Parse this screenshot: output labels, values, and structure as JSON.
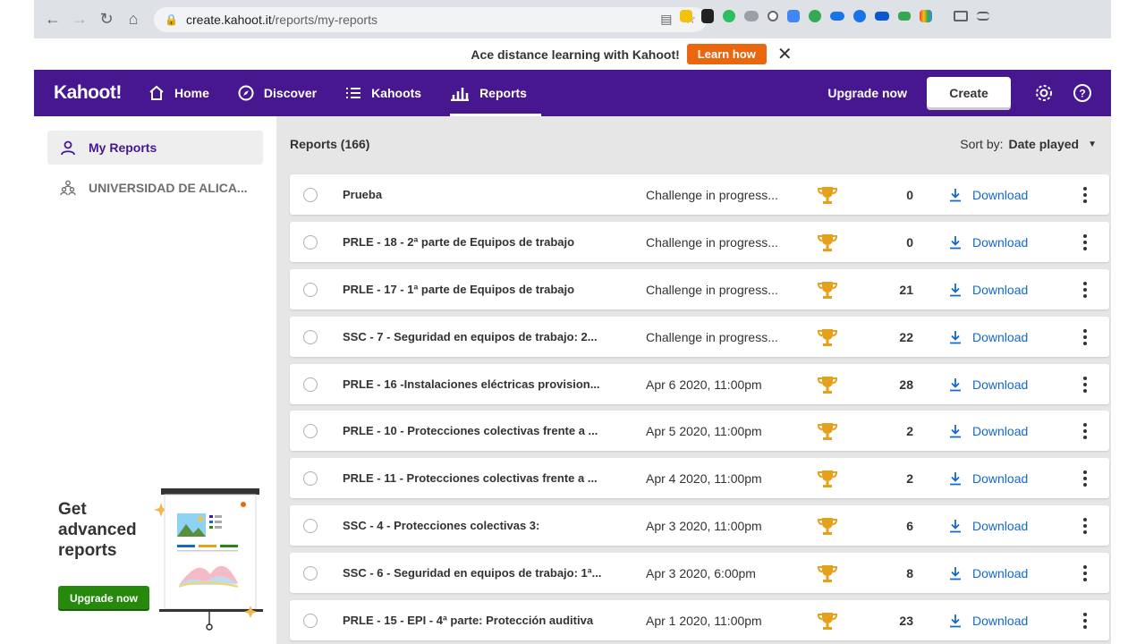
{
  "browser": {
    "url_host": "create.kahoot.it",
    "url_path": "/reports/my-reports"
  },
  "banner": {
    "message": "Ace distance learning with Kahoot!",
    "cta": "Learn how"
  },
  "topbar": {
    "logo": "Kahoot!",
    "nav": [
      {
        "label": "Home",
        "icon": "home-icon"
      },
      {
        "label": "Discover",
        "icon": "compass-icon"
      },
      {
        "label": "Kahoots",
        "icon": "list-icon"
      },
      {
        "label": "Reports",
        "icon": "bar-chart-icon",
        "active": true
      }
    ],
    "upgrade": "Upgrade now",
    "create": "Create"
  },
  "sidebar": {
    "items": [
      {
        "label": "My Reports",
        "icon": "user-icon",
        "active": true
      },
      {
        "label": "UNIVERSIDAD DE ALICA...",
        "icon": "group-icon",
        "active": false
      }
    ],
    "promo": {
      "title": "Get advanced reports",
      "button": "Upgrade now"
    }
  },
  "main": {
    "heading": "Reports (166)",
    "sort_label": "Sort by:",
    "sort_value": "Date played",
    "download_label": "Download",
    "rows": [
      {
        "title": "Prueba",
        "status": "Challenge in progress...",
        "count": "0"
      },
      {
        "title": "PRLE - 18 - 2ª parte de Equipos de trabajo",
        "status": "Challenge in progress...",
        "count": "0"
      },
      {
        "title": "PRLE - 17 - 1ª parte de Equipos de trabajo",
        "status": "Challenge in progress...",
        "count": "21"
      },
      {
        "title": "SSC - 7 - Seguridad en equipos de trabajo: 2...",
        "status": "Challenge in progress...",
        "count": "22"
      },
      {
        "title": "PRLE - 16 -Instalaciones eléctricas provision...",
        "status": "Apr 6 2020, 11:00pm",
        "count": "28"
      },
      {
        "title": "PRLE - 10 - Protecciones colectivas frente a ...",
        "status": "Apr 5 2020, 11:00pm",
        "count": "2"
      },
      {
        "title": "PRLE - 11 - Protecciones colectivas frente a ...",
        "status": "Apr 4 2020, 11:00pm",
        "count": "2"
      },
      {
        "title": "SSC - 4 - Protecciones colectivas 3:",
        "status": "Apr 3 2020, 11:00pm",
        "count": "6"
      },
      {
        "title": "SSC - 6 - Seguridad en equipos de trabajo: 1ª...",
        "status": "Apr 3 2020, 6:00pm",
        "count": "8"
      },
      {
        "title": "PRLE - 15 - EPI - 4ª parte: Protección auditiva",
        "status": "Apr 1 2020, 11:00pm",
        "count": "23"
      }
    ]
  },
  "colors": {
    "brand_purple": "#46178f",
    "learn_orange": "#eb670f",
    "upgrade_green": "#26890c",
    "link_blue": "#1368ce",
    "trophy_gold": "#e5a11c"
  }
}
